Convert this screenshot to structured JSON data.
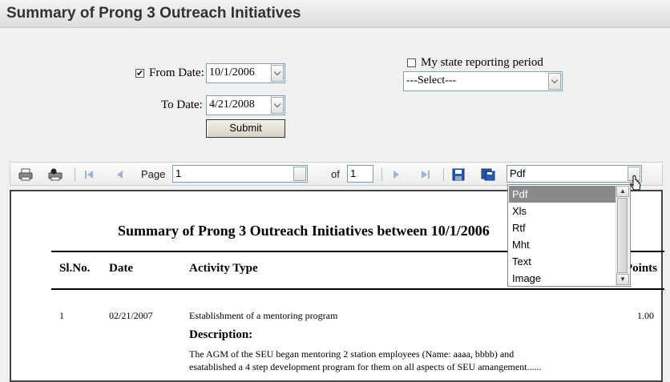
{
  "header": {
    "title": "Summary of Prong 3 Outreach Initiatives"
  },
  "filters": {
    "from_date_label": "From Date:",
    "from_date_value": "10/1/2006",
    "from_date_checked": "✔",
    "to_date_label": "To Date:",
    "to_date_value": "4/21/2008",
    "submit_label": "Submit",
    "state_period_label": "My state reporting period",
    "state_period_select": "---Select---"
  },
  "toolbar": {
    "page_label": "Page",
    "page_value": "1",
    "of_label": "of",
    "of_value": "1",
    "export_format": "Pdf",
    "export_options": [
      "Pdf",
      "Xls",
      "Rtf",
      "Mht",
      "Text",
      "Image"
    ]
  },
  "report": {
    "title": "Summary of Prong 3 Outreach Initiatives between 10/1/2006",
    "columns": {
      "sl": "Sl.No.",
      "date": "Date",
      "activity": "Activity Type",
      "points": "Points"
    },
    "rows": [
      {
        "sl": "1",
        "date": "02/21/2007",
        "activity": "Establishment of a mentoring program",
        "points": "1.00",
        "description_label": "Description:",
        "description_line1": "The AGM of the SEU began mentoring 2 station employees (Name: aaaa, bbbb) and",
        "description_line2": "esatablished a 4 step development program for them on all aspects of SEU amangement......"
      }
    ]
  },
  "colors": {
    "accent": "#316ac5",
    "selected_item": "#8a8a8a"
  }
}
